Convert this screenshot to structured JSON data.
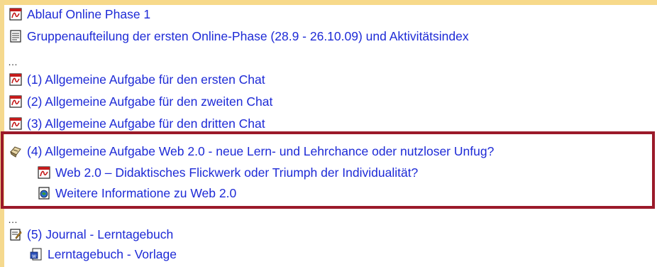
{
  "items": [
    {
      "label": "Ablauf Online Phase 1",
      "icon": "pdf-icon"
    },
    {
      "label": "Gruppenaufteilung der ersten Online-Phase (28.9 - 26.10.09) und Aktivitätsindex",
      "icon": "document-icon"
    },
    {
      "label": "(1) Allgemeine Aufgabe für den ersten Chat",
      "icon": "pdf-icon"
    },
    {
      "label": "(2) Allgemeine Aufgabe für den zweiten Chat",
      "icon": "pdf-icon"
    },
    {
      "label": "(3) Allgemeine Aufgabe für den dritten Chat",
      "icon": "pdf-icon"
    },
    {
      "label": "(4) Allgemeine Aufgabe Web 2.0 - neue Lern- und Lehrchance oder nutzloser Unfug?",
      "icon": "forum-icon"
    },
    {
      "label": "Web 2.0 – Didaktisches Flickwerk oder Triumph der Individualität?",
      "icon": "pdf-icon"
    },
    {
      "label": "Weitere Informatione zu Web 2.0",
      "icon": "web-link-icon"
    },
    {
      "label": "(5) Journal - Lerntagebuch",
      "icon": "journal-icon"
    },
    {
      "label": "Lerntagebuch - Vorlage",
      "icon": "word-doc-icon"
    }
  ],
  "ellipsis": [
    "…",
    "…"
  ],
  "colors": {
    "link": "#1d2ad6",
    "highlight_border": "#9b1a2a",
    "header_bar": "#f7d98a"
  }
}
